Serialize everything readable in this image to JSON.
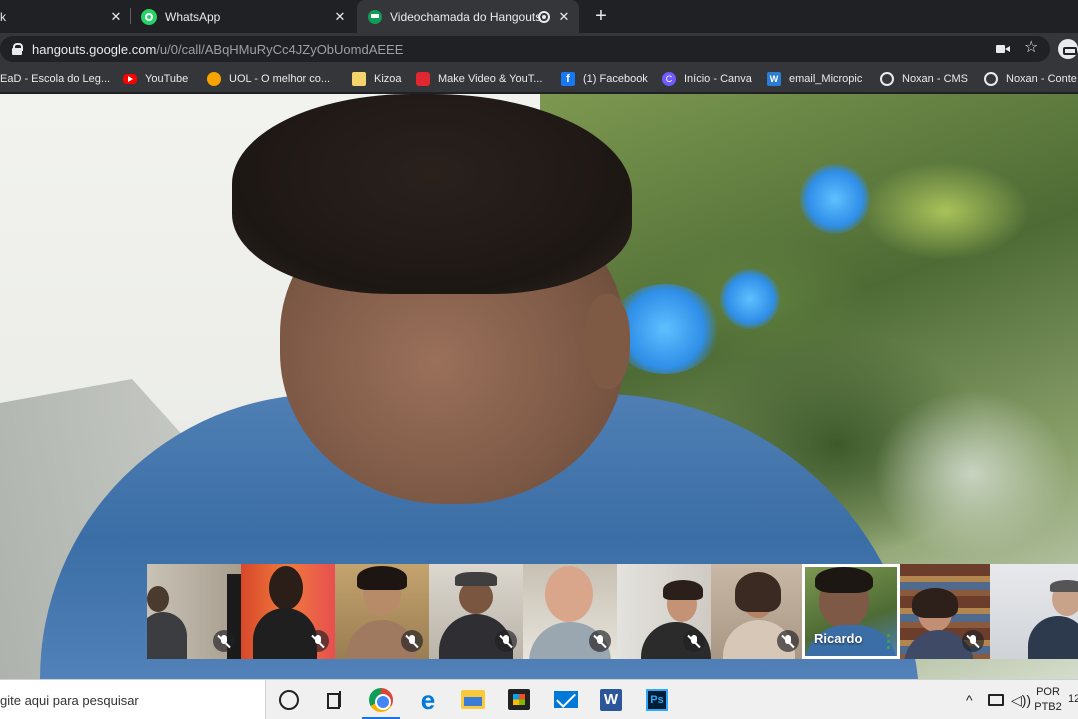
{
  "browser": {
    "tabs": [
      {
        "title": "k",
        "active": false
      },
      {
        "title": "WhatsApp",
        "active": false
      },
      {
        "title": "Videochamada do Hangouts",
        "active": true
      }
    ],
    "url_host": "hangouts.google.com",
    "url_path": "/u/0/call/ABqHMuRyCc4JZyObUomdAEEE"
  },
  "bookmarks": [
    {
      "label": "EaD - Escola do Leg...",
      "icon": "bookmark-icon"
    },
    {
      "label": "YouTube",
      "icon": "youtube-icon",
      "color": "#ff0000"
    },
    {
      "label": "UOL - O melhor co...",
      "icon": "uol-icon",
      "color": "#f7a300"
    },
    {
      "label": "Kizoa",
      "icon": "kizoa-icon",
      "color": "#f3d36b"
    },
    {
      "label": "Make Video & YouT...",
      "icon": "make-video-icon",
      "color": "#e0262e"
    },
    {
      "label": "(1) Facebook",
      "icon": "facebook-icon",
      "color": "#1877f2"
    },
    {
      "label": "Início - Canva",
      "icon": "canva-icon",
      "color": "#6f5bff"
    },
    {
      "label": "email_Micropic",
      "icon": "word-doc-icon",
      "color": "#2b7cd3"
    },
    {
      "label": "Noxan - CMS",
      "icon": "globe-icon",
      "color": "#e8eaed"
    },
    {
      "label": "Noxan - Conte",
      "icon": "globe-icon",
      "color": "#e8eaed"
    }
  ],
  "call": {
    "selected_participant_name": "Ricardo",
    "participant_count_visible": 10
  },
  "taskbar": {
    "search_placeholder": "gite aqui para pesquisar",
    "language_line1": "POR",
    "language_line2": "PTB2",
    "clock": "12"
  },
  "colors": {
    "chrome_dark": "#202124",
    "chrome_toolbar": "#35363a",
    "hangouts_green": "#34a853",
    "taskbar": "#f0f0f0"
  }
}
